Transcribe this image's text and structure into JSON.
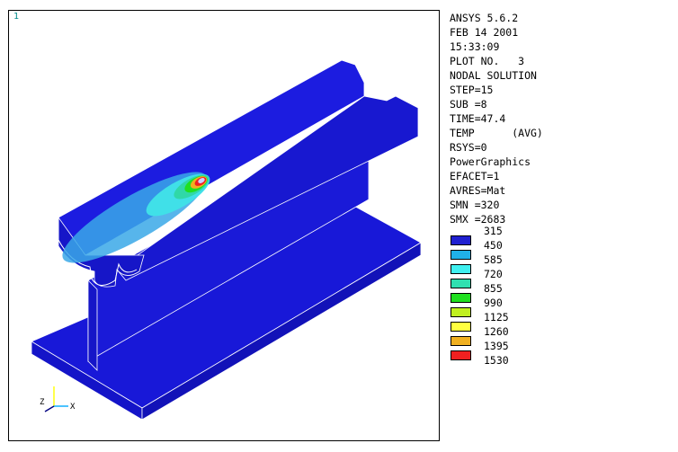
{
  "viewport": {
    "window_number": "1"
  },
  "info": {
    "lines": [
      "ANSYS 5.6.2",
      "FEB 14 2001",
      "15:33:09",
      "PLOT NO.   3",
      "NODAL SOLUTION",
      "STEP=15",
      "SUB =8",
      "TIME=47.4",
      "TEMP      (AVG)",
      "RSYS=0",
      "PowerGraphics",
      "EFACET=1",
      "AVRES=Mat",
      "SMN =320",
      "SMX =2683"
    ]
  },
  "legend": {
    "top_label": "315",
    "items": [
      {
        "color": "#2020d0",
        "label": "450"
      },
      {
        "color": "#20b0e8",
        "label": "585"
      },
      {
        "color": "#40f0f0",
        "label": "720"
      },
      {
        "color": "#30e0b0",
        "label": "855"
      },
      {
        "color": "#20e020",
        "label": "990"
      },
      {
        "color": "#c0f020",
        "label": "1125"
      },
      {
        "color": "#ffff40",
        "label": "1260"
      },
      {
        "color": "#f0b020",
        "label": "1395"
      },
      {
        "color": "#f02020",
        "label": "1530"
      }
    ]
  },
  "triad": {
    "z_label": "Z",
    "x_label": "X"
  }
}
